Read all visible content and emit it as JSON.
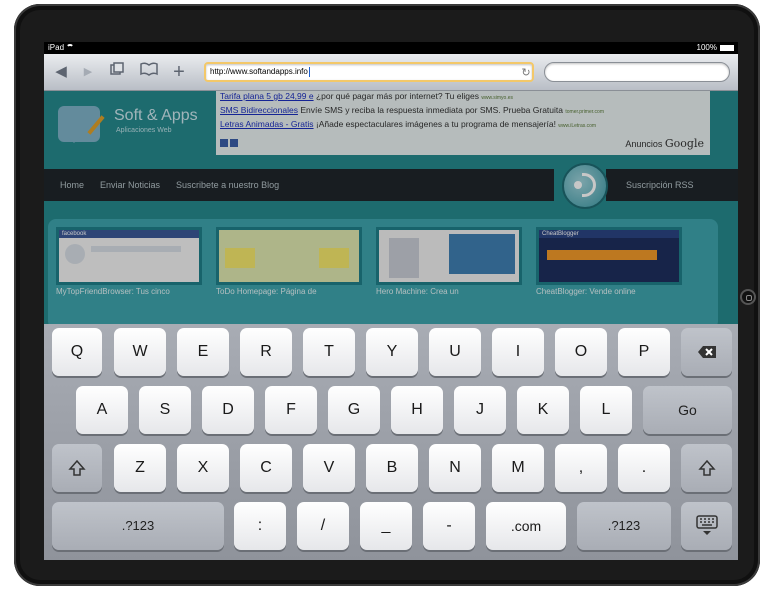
{
  "status_bar": {
    "device": "iPad",
    "battery": "100%"
  },
  "toolbar": {
    "url": "http://www.softandapps.info",
    "search_placeholder": ""
  },
  "site": {
    "title": "Soft & Apps",
    "subtitle": "Aplicaciones Web",
    "ads": {
      "line1_link": "Tarifa plana 5 gb 24,99 e",
      "line1_text": " ¿por qué pagar más por internet? Tu eliges ",
      "line1_small": "www.simyo.es",
      "line2_link": "SMS Bidireccionales",
      "line2_text": " Envíe SMS y reciba la respuesta inmediata por SMS. Prueba Gratuita ",
      "line2_small": "tomer.primer.com",
      "line3_link": "Letras Animadas - Gratis",
      "line3_text": " ¡Añade espectaculares imágenes a tu programa de mensajería! ",
      "line3_small": "www.iLetras.com",
      "footer_prefix": "Anuncios",
      "footer_brand": "Google"
    },
    "nav": [
      "Home",
      "Enviar Noticias",
      "Suscribete a nuestro Blog"
    ],
    "rss_label": "Suscripción RSS",
    "thumbs": [
      {
        "label": "MyTopFriendBrowser: Tus cinco",
        "header": "facebook"
      },
      {
        "label": "ToDo Homepage: Página de",
        "header": ""
      },
      {
        "label": "Hero Machine: Crea un",
        "header": ""
      },
      {
        "label": "CheatBlogger: Vende online",
        "header": "CheatBlogger"
      }
    ]
  },
  "keyboard": {
    "row1": [
      "Q",
      "W",
      "E",
      "R",
      "T",
      "Y",
      "U",
      "I",
      "O",
      "P"
    ],
    "row2": [
      "A",
      "S",
      "D",
      "F",
      "G",
      "H",
      "J",
      "K",
      "L"
    ],
    "go": "Go",
    "row3": [
      "Z",
      "X",
      "C",
      "V",
      "B",
      "N",
      "M",
      ",",
      "."
    ],
    "row4": [
      ".?123",
      ":",
      "/",
      "_",
      "-",
      ".com",
      ".?123"
    ]
  },
  "icons": [
    "back-icon",
    "forward-icon",
    "pages-icon",
    "bookmarks-icon",
    "add-icon",
    "reload-icon",
    "backspace-icon",
    "shift-icon",
    "hide-keyboard-icon",
    "wifi-icon",
    "battery-icon"
  ],
  "colors": {
    "toolbar_focus": "#f3c869",
    "site_bg": "#26898e",
    "keyboard_bg": "#9da1a9"
  }
}
